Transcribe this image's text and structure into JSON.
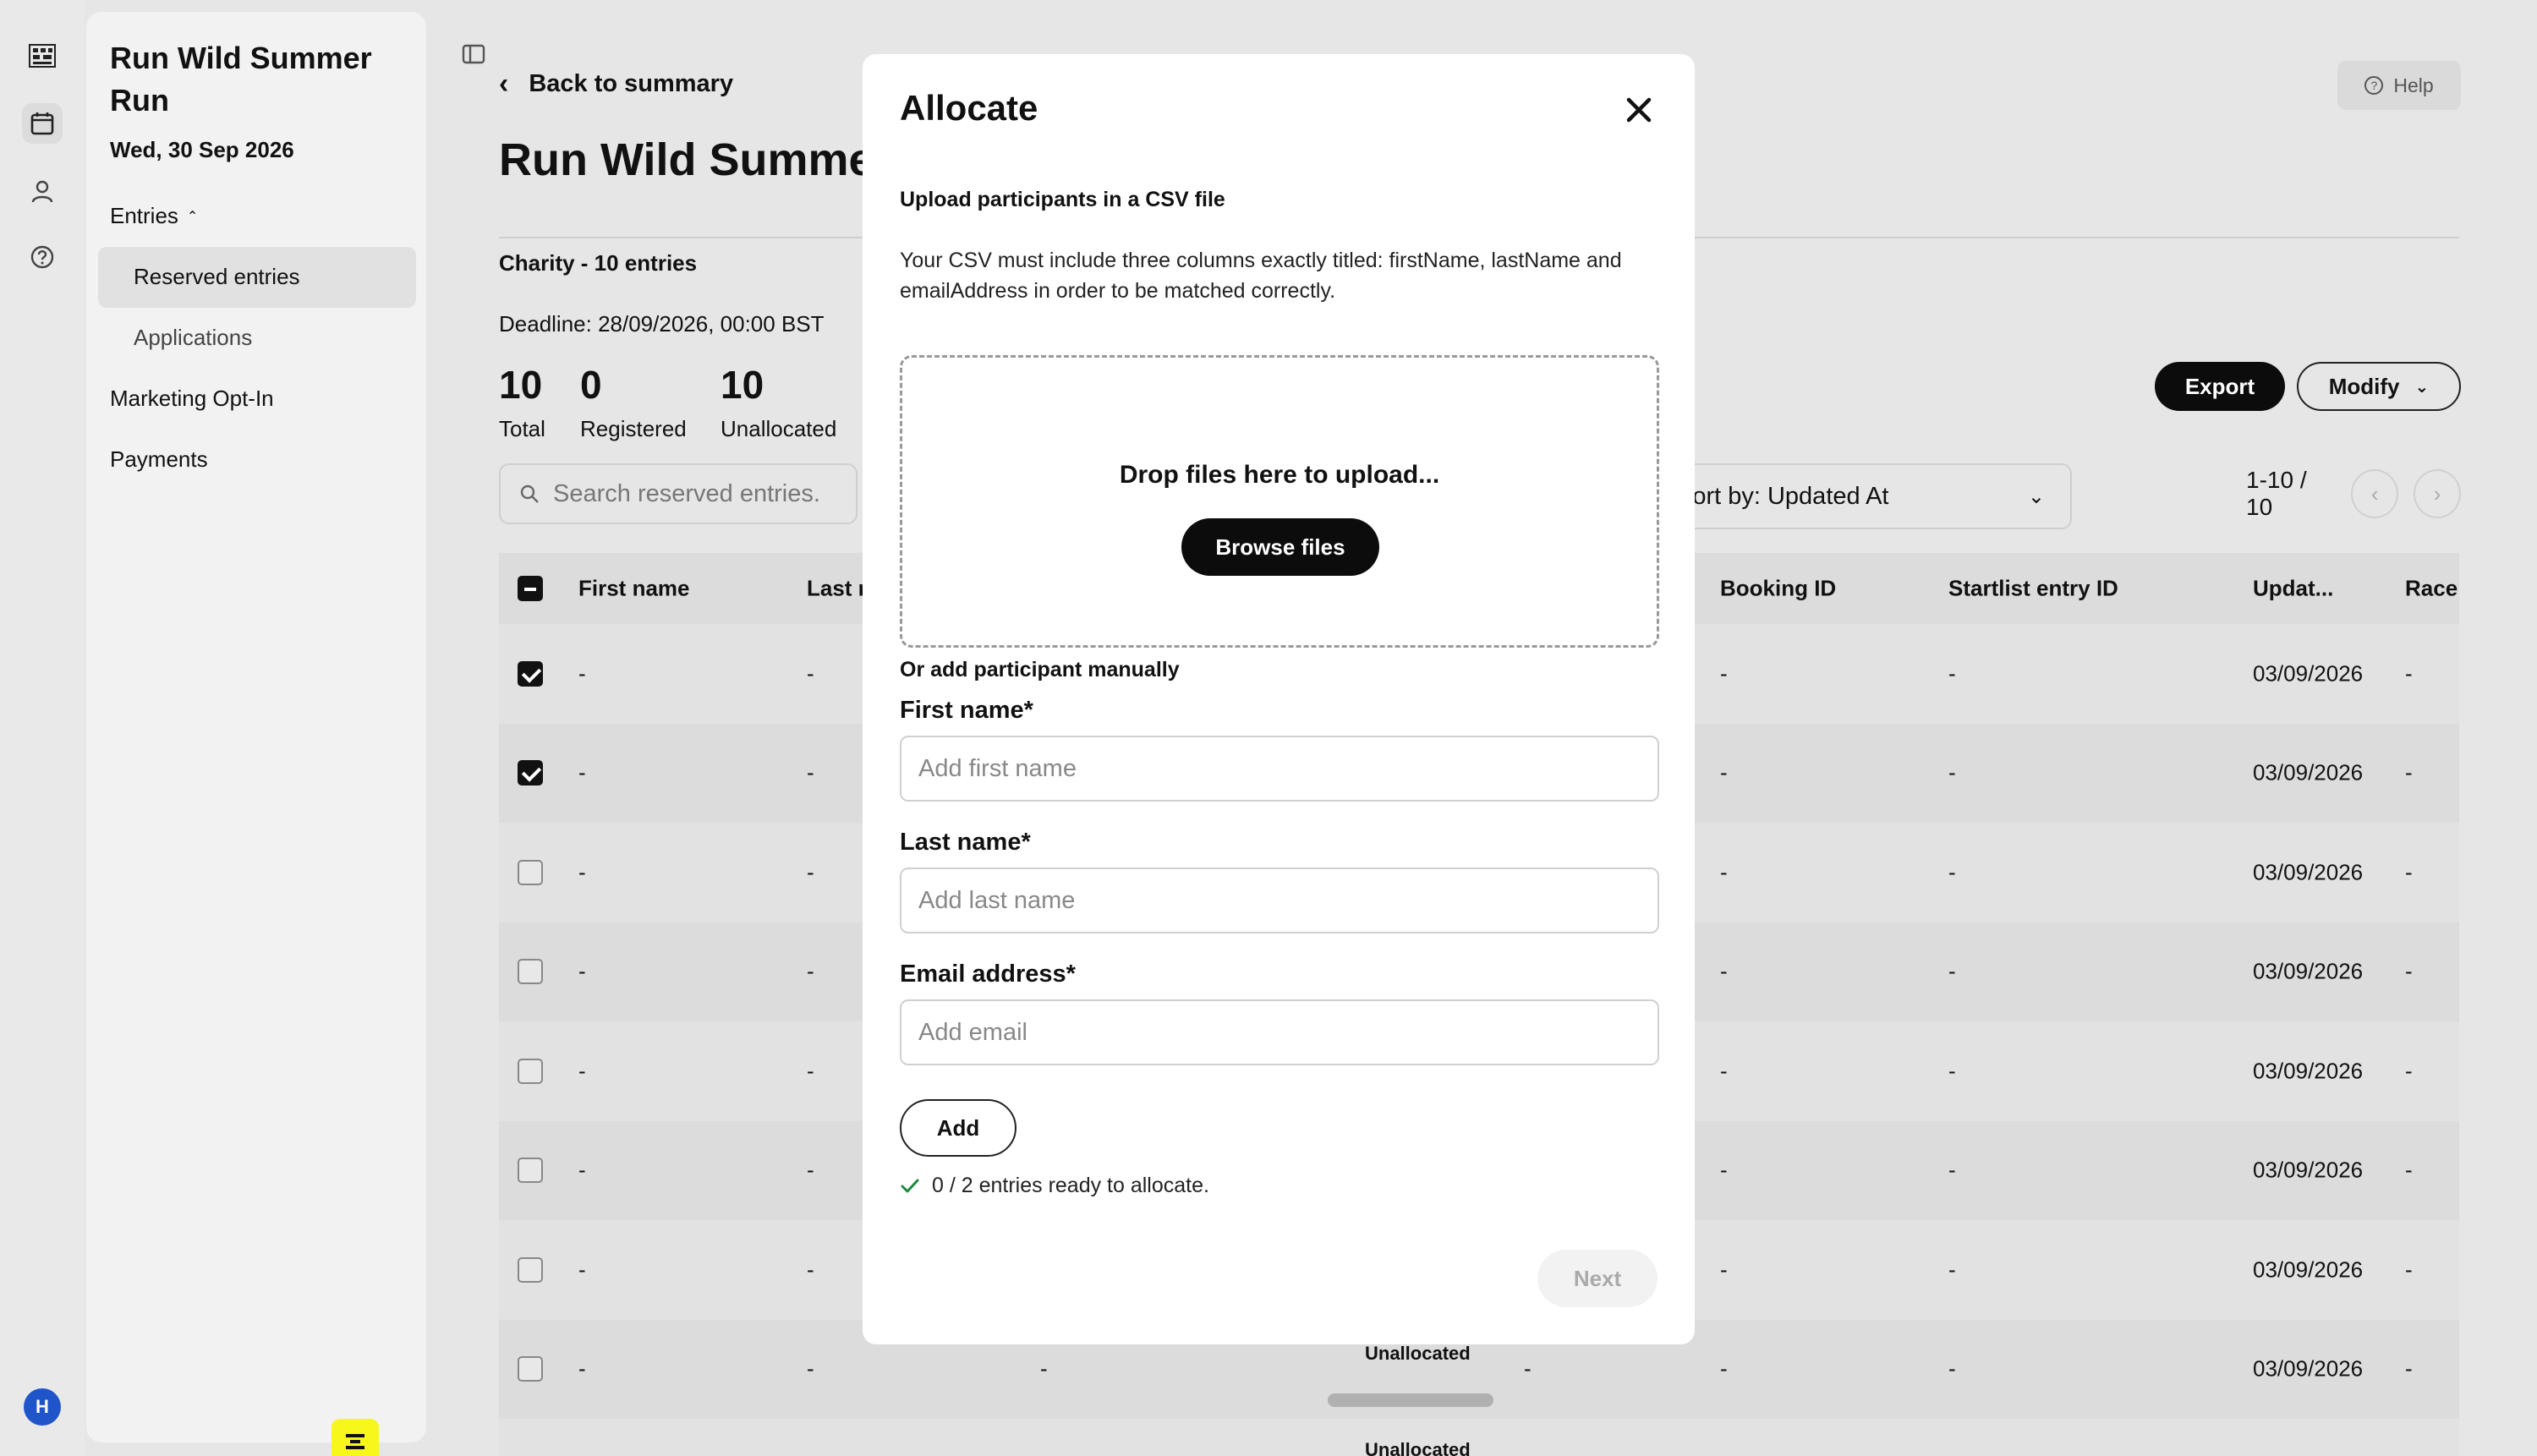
{
  "app": {
    "event_title": "Run Wild Summer Run",
    "event_date": "Wed, 30 Sep 2026",
    "nav": {
      "entries": "Entries",
      "reserved_entries": "Reserved entries",
      "applications": "Applications",
      "marketing": "Marketing Opt-In",
      "payments": "Payments"
    },
    "avatar_initial": "H"
  },
  "main": {
    "back_label": "Back to summary",
    "page_title": "Run Wild Summer Run",
    "charity": "Charity - 10 entries",
    "deadline": "Deadline: 28/09/2026, 00:00 BST",
    "stats": [
      {
        "value": "10",
        "label": "Total"
      },
      {
        "value": "0",
        "label": "Registered"
      },
      {
        "value": "10",
        "label": "Unallocated"
      }
    ],
    "help_label": "Help",
    "export_label": "Export",
    "modify_label": "Modify",
    "search_placeholder": "Search reserved entries.",
    "sort_label": "Sort by: Updated At",
    "pager": "1-10 / 10"
  },
  "table": {
    "headers": {
      "first_name": "First name",
      "last_name": "Last name",
      "booking_id": "Booking ID",
      "startlist_id": "Startlist entry ID",
      "updated": "Updat...",
      "race": "Race"
    },
    "rows": [
      {
        "checked": true,
        "first": "-",
        "last": "-",
        "booking": "-",
        "startlist": "-",
        "updated": "03/09/2026",
        "race": "-"
      },
      {
        "checked": true,
        "first": "-",
        "last": "-",
        "booking": "-",
        "startlist": "-",
        "updated": "03/09/2026",
        "race": "-"
      },
      {
        "checked": false,
        "first": "-",
        "last": "-",
        "booking": "-",
        "startlist": "-",
        "updated": "03/09/2026",
        "race": "-"
      },
      {
        "checked": false,
        "first": "-",
        "last": "-",
        "booking": "-",
        "startlist": "-",
        "updated": "03/09/2026",
        "race": "-"
      },
      {
        "checked": false,
        "first": "-",
        "last": "-",
        "booking": "-",
        "startlist": "-",
        "updated": "03/09/2026",
        "race": "-"
      },
      {
        "checked": false,
        "first": "-",
        "last": "-",
        "booking": "-",
        "startlist": "-",
        "updated": "03/09/2026",
        "race": "-"
      },
      {
        "checked": false,
        "first": "-",
        "last": "-",
        "booking": "-",
        "startlist": "-",
        "updated": "03/09/2026",
        "race": "-"
      },
      {
        "checked": false,
        "first": "-",
        "last": "-",
        "col3": "-",
        "status": "Unallocated",
        "col5": "-",
        "booking": "-",
        "startlist": "-",
        "updated": "03/09/2026",
        "race": "-"
      }
    ],
    "partial_row_status": "Unallocated"
  },
  "modal": {
    "title": "Allocate",
    "upload_heading": "Upload participants in a CSV file",
    "upload_desc": "Your CSV must include three columns exactly titled: firstName, lastName and emailAddress in order to be matched correctly.",
    "drop_text": "Drop files here to upload...",
    "browse_label": "Browse files",
    "manual_heading": "Or add participant manually",
    "first_name_label": "First name*",
    "first_name_placeholder": "Add first name",
    "last_name_label": "Last name*",
    "last_name_placeholder": "Add last name",
    "email_label": "Email address*",
    "email_placeholder": "Add email",
    "add_label": "Add",
    "ready_text": "0 / 2 entries ready to allocate.",
    "next_label": "Next"
  },
  "colors": {
    "accent": "#0c0c0c",
    "logo_yellow": "#f7f71c",
    "avatar_blue": "#1f55c9",
    "check_green": "#1c8a3c"
  }
}
